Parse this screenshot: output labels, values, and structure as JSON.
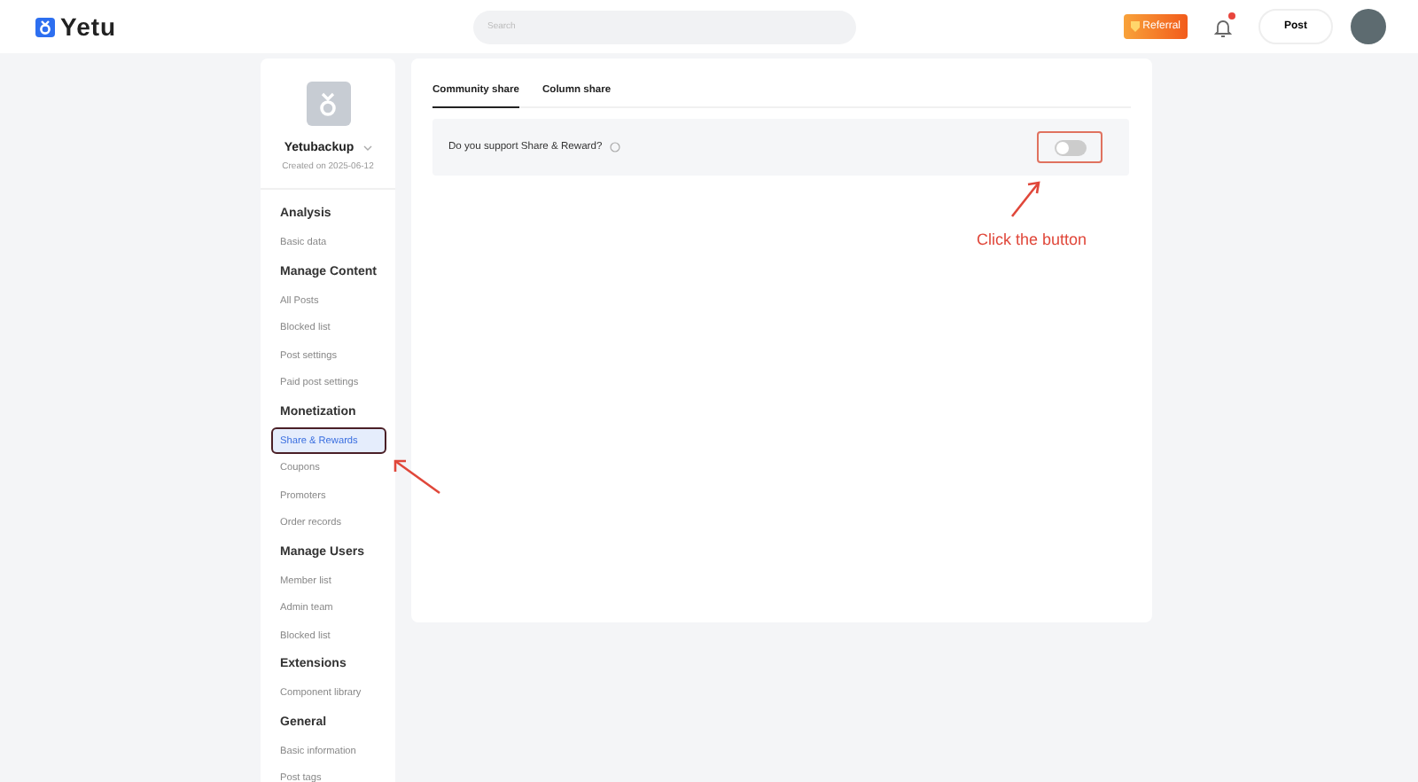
{
  "header": {
    "logo": "Yetu",
    "search": {
      "placeholder": "Search"
    },
    "referral": "Referral",
    "notifications": {
      "unread": true
    },
    "post_button": "Post"
  },
  "profile": {
    "name": "Yetubackup",
    "created": "Created on 2025-06-12"
  },
  "sidebar": {
    "sections": [
      {
        "title": "Analysis",
        "items": [
          {
            "label": "Basic data",
            "selected": false
          }
        ]
      },
      {
        "title": "Manage Content",
        "items": [
          {
            "label": "All Posts",
            "selected": false
          },
          {
            "label": "Blocked list",
            "selected": false
          },
          {
            "label": "Post settings",
            "selected": false
          },
          {
            "label": "Paid post settings",
            "selected": false
          }
        ]
      },
      {
        "title": "Monetization",
        "items": [
          {
            "label": "Share & Rewards",
            "selected": true
          },
          {
            "label": "Coupons",
            "selected": false
          },
          {
            "label": "Promoters",
            "selected": false
          },
          {
            "label": "Order records",
            "selected": false
          }
        ]
      },
      {
        "title": "Manage Users",
        "items": [
          {
            "label": "Member list",
            "selected": false
          },
          {
            "label": "Admin team",
            "selected": false
          },
          {
            "label": "Blocked list",
            "selected": false
          }
        ]
      },
      {
        "title": "Extensions",
        "items": [
          {
            "label": "Component library",
            "selected": false
          }
        ]
      },
      {
        "title": "General",
        "items": [
          {
            "label": "Basic information",
            "selected": false
          },
          {
            "label": "Post tags",
            "selected": false
          }
        ]
      }
    ]
  },
  "tabs": [
    {
      "label": "Community share",
      "selected": true
    },
    {
      "label": "Column share",
      "selected": false
    }
  ],
  "setting": {
    "label": "Do you support Share & Reward?",
    "on": false
  },
  "annotation": {
    "text": "Click the button"
  }
}
